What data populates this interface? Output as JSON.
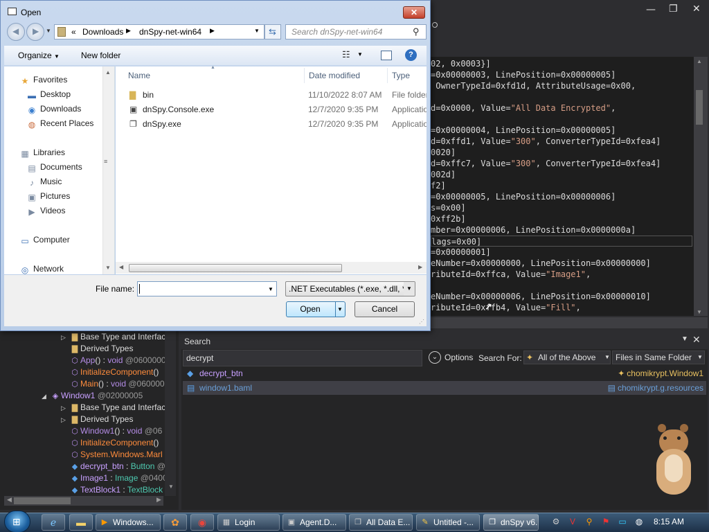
{
  "dialog": {
    "title": "Open",
    "close_label": "✕",
    "breadcrumb": [
      "«",
      "Downloads",
      "dnSpy-net-win64"
    ],
    "search_placeholder": "Search dnSpy-net-win64",
    "toolbar": {
      "organize": "Organize",
      "new_folder": "New folder"
    },
    "nav_items": [
      {
        "label": "Favorites",
        "icon": "star-icon",
        "level": 0
      },
      {
        "label": "Desktop",
        "icon": "desktop-icon",
        "level": 1
      },
      {
        "label": "Downloads",
        "icon": "downloads-icon",
        "level": 1
      },
      {
        "label": "Recent Places",
        "icon": "recent-places-icon",
        "level": 1
      },
      {
        "label": "Libraries",
        "icon": "libraries-icon",
        "level": 0
      },
      {
        "label": "Documents",
        "icon": "documents-icon",
        "level": 1
      },
      {
        "label": "Music",
        "icon": "music-icon",
        "level": 1
      },
      {
        "label": "Pictures",
        "icon": "pictures-icon",
        "level": 1
      },
      {
        "label": "Videos",
        "icon": "videos-icon",
        "level": 1
      },
      {
        "label": "Computer",
        "icon": "computer-icon",
        "level": 0
      },
      {
        "label": "Network",
        "icon": "network-icon",
        "level": 0
      }
    ],
    "columns": {
      "name": "Name",
      "date": "Date modified",
      "type": "Type"
    },
    "files": [
      {
        "name": "bin",
        "date": "11/10/2022 8:07 AM",
        "type": "File folder",
        "icon": "folder-icon"
      },
      {
        "name": "dnSpy.Console.exe",
        "date": "12/7/2020 9:35 PM",
        "type": "Application",
        "icon": "console-exe-icon"
      },
      {
        "name": "dnSpy.exe",
        "date": "12/7/2020 9:35 PM",
        "type": "Application",
        "icon": "exe-icon"
      }
    ],
    "file_name_label": "File name:",
    "file_name_value": "",
    "filter": ".NET Executables (*.exe, *.dll, *.netmodule)",
    "open_label": "Open",
    "cancel_label": "Cancel"
  },
  "dnspy": {
    "window_controls": [
      "—",
      "❐",
      "✕"
    ],
    "code_lines": [
      [
        [
          "t",
          "02, 0x0003}]"
        ]
      ],
      [
        [
          "t",
          "=0x00000003, LinePosition=0x00000005]"
        ]
      ],
      [
        [
          "t",
          " OwnerTypeId=0xfd1d, AttributeUsage=0x00,"
        ]
      ],
      [
        [
          "t",
          ""
        ]
      ],
      [
        [
          "t",
          "d=0x0000, Value="
        ],
        [
          "s",
          "\"All Data Encrypted\""
        ],
        [
          "t",
          ","
        ]
      ],
      [
        [
          "t",
          ""
        ]
      ],
      [
        [
          "t",
          "=0x00000004, LinePosition=0x00000005]"
        ]
      ],
      [
        [
          "t",
          "d=0xffd1, Value="
        ],
        [
          "s",
          "\"300\""
        ],
        [
          "t",
          ", ConverterTypeId=0xfea4]"
        ]
      ],
      [
        [
          "t",
          "0020]"
        ]
      ],
      [
        [
          "t",
          "d=0xffc7, Value="
        ],
        [
          "s",
          "\"300\""
        ],
        [
          "t",
          ", ConverterTypeId=0xfea4]"
        ]
      ],
      [
        [
          "t",
          "002d]"
        ]
      ],
      [
        [
          "t",
          "f2]"
        ]
      ],
      [
        [
          "t",
          "=0x00000005, LinePosition=0x00000006]"
        ]
      ],
      [
        [
          "t",
          "s=0x00]"
        ]
      ],
      [
        [
          "t",
          "0xff2b]"
        ]
      ],
      [
        [
          "t",
          "mber=0x00000006, LinePosition=0x0000000a]"
        ]
      ],
      [
        [
          "t",
          "lags=0x00]"
        ]
      ],
      [
        [
          "t",
          "=0x00000001]"
        ]
      ],
      [
        [
          "t",
          "eNumber=0x00000000, LinePosition=0x00000000]"
        ]
      ],
      [
        [
          "t",
          "ributeId=0xffca, Value="
        ],
        [
          "s",
          "\"Image1\""
        ],
        [
          "t",
          ","
        ]
      ],
      [
        [
          "t",
          ""
        ]
      ],
      [
        [
          "t",
          "eNumber=0x00000006, LinePosition=0x00000010]"
        ]
      ],
      [
        [
          "t",
          "ributeId=0xffb4, Value="
        ],
        [
          "s",
          "\"Fill\""
        ],
        [
          "t",
          ","
        ]
      ]
    ],
    "tree": [
      {
        "indent": 90,
        "arrow": "▷",
        "icon": "folder-icon",
        "parts": [
          [
            "c-white",
            "Base Type and Interfac"
          ]
        ]
      },
      {
        "indent": 90,
        "arrow": "",
        "icon": "folder-icon",
        "parts": [
          [
            "c-white",
            "Derived Types"
          ]
        ]
      },
      {
        "indent": 90,
        "arrow": "",
        "icon": "method-icon",
        "parts": [
          [
            "c-purple",
            "App"
          ],
          [
            "c-white",
            "() : "
          ],
          [
            "c-purple",
            "void"
          ],
          [
            "c-gray",
            " @0600000"
          ]
        ]
      },
      {
        "indent": 90,
        "arrow": "",
        "icon": "method-icon",
        "parts": [
          [
            "c-orange",
            "InitializeComponent"
          ],
          [
            "c-white",
            "()"
          ]
        ]
      },
      {
        "indent": 90,
        "arrow": "",
        "icon": "method-icon",
        "parts": [
          [
            "c-orange",
            "Main"
          ],
          [
            "c-white",
            "() : "
          ],
          [
            "c-purple",
            "void"
          ],
          [
            "c-gray",
            " @060000"
          ]
        ]
      },
      {
        "indent": 62,
        "arrow": "◢",
        "icon": "class-icon",
        "parts": [
          [
            "c-ltpurple",
            "Window1"
          ],
          [
            "c-gray",
            " @02000005"
          ]
        ]
      },
      {
        "indent": 90,
        "arrow": "▷",
        "icon": "folder-icon",
        "parts": [
          [
            "c-white",
            "Base Type and Interfac"
          ]
        ]
      },
      {
        "indent": 90,
        "arrow": "▷",
        "icon": "folder-icon",
        "parts": [
          [
            "c-white",
            "Derived Types"
          ]
        ]
      },
      {
        "indent": 90,
        "arrow": "",
        "icon": "method-icon",
        "parts": [
          [
            "c-purple",
            "Window1"
          ],
          [
            "c-white",
            "() : "
          ],
          [
            "c-purple",
            "void"
          ],
          [
            "c-gray",
            " @06"
          ]
        ]
      },
      {
        "indent": 90,
        "arrow": "",
        "icon": "method-icon",
        "parts": [
          [
            "c-orange",
            "InitializeComponent"
          ],
          [
            "c-white",
            "()"
          ]
        ]
      },
      {
        "indent": 90,
        "arrow": "",
        "icon": "method-icon",
        "parts": [
          [
            "c-orange",
            "System.Windows.Marl"
          ]
        ]
      },
      {
        "indent": 90,
        "arrow": "",
        "icon": "field-icon",
        "parts": [
          [
            "c-ltpurple",
            "decrypt_btn"
          ],
          [
            "c-white",
            " : "
          ],
          [
            "c-blue",
            "Button"
          ],
          [
            "c-gray",
            " @"
          ]
        ]
      },
      {
        "indent": 90,
        "arrow": "",
        "icon": "field-icon",
        "parts": [
          [
            "c-ltpurple",
            "Image1"
          ],
          [
            "c-white",
            " : "
          ],
          [
            "c-blue",
            "Image"
          ],
          [
            "c-gray",
            " @0400"
          ]
        ]
      },
      {
        "indent": 90,
        "arrow": "",
        "icon": "field-icon",
        "parts": [
          [
            "c-ltpurple",
            "TextBlock1"
          ],
          [
            "c-white",
            " : "
          ],
          [
            "c-blue",
            "TextBlock"
          ]
        ]
      }
    ],
    "search": {
      "title": "Search",
      "query": "decrypt",
      "options_label": "Options",
      "search_for_label": "Search For:",
      "search_for_value": "All of the Above",
      "scope_value": "Files in Same Folder",
      "results": [
        {
          "name": "decrypt_btn",
          "location": "chomikrypt.Window1",
          "selected": false
        },
        {
          "name": "window1.baml",
          "location": "chomikrypt.g.resources",
          "selected": true
        }
      ]
    }
  },
  "taskbar": {
    "items": [
      {
        "label": "Windows...",
        "icon": "media-player-icon",
        "active": false
      },
      {
        "label": "Login",
        "icon": "login-app-icon",
        "active": false
      },
      {
        "label": "Agent.D...",
        "icon": "agent-window-icon",
        "active": false
      },
      {
        "label": "All Data E...",
        "icon": "window-icon",
        "active": false
      },
      {
        "label": "Untitled -...",
        "icon": "paint-icon",
        "active": false
      },
      {
        "label": "dnSpy v6...",
        "icon": "dnspy-icon",
        "active": true
      }
    ],
    "clock": "8:15 AM"
  }
}
